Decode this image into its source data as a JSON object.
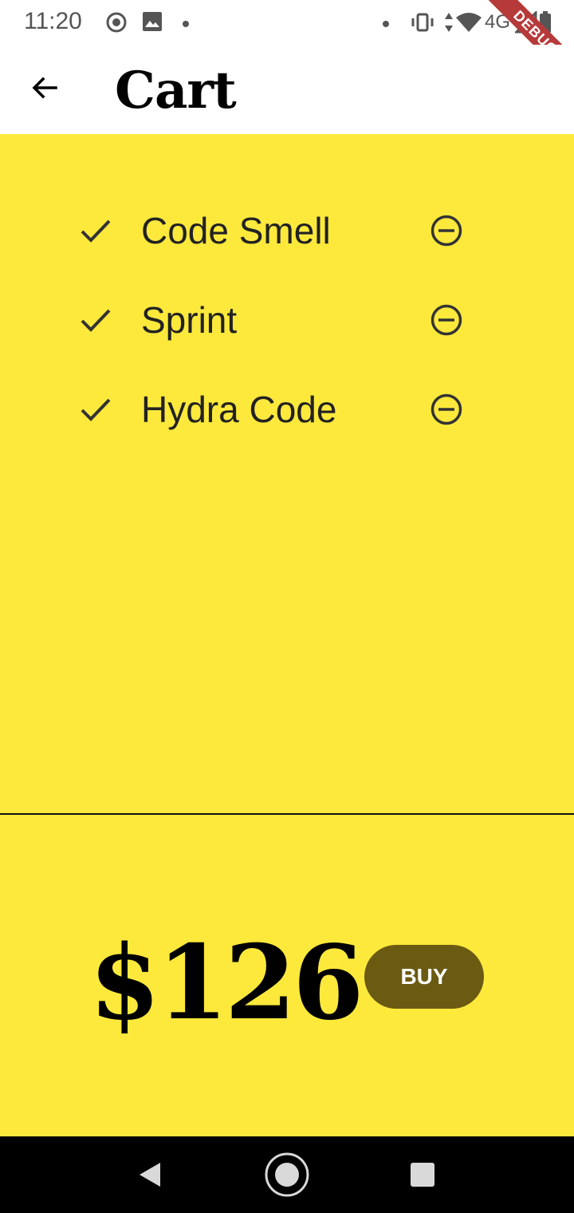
{
  "status_bar": {
    "time": "11:20",
    "network": "4G",
    "debug_label": "DEBUG",
    "icons": [
      "play-circle-icon",
      "image-icon",
      "notification-dot-icon",
      "vibrate-icon",
      "data-arrows-icon",
      "wifi-icon",
      "signal-icon",
      "battery-icon"
    ]
  },
  "app_bar": {
    "title": "Cart",
    "back_icon": "arrow-left-icon"
  },
  "cart": {
    "items": [
      {
        "label": "Code Smell"
      },
      {
        "label": "Sprint"
      },
      {
        "label": "Hydra Code"
      }
    ],
    "item_icon": "check-icon",
    "remove_icon": "remove-circle-icon"
  },
  "total": {
    "price": "$126",
    "buy_label": "BUY"
  },
  "nav_bar": {
    "icons": [
      "back-triangle-icon",
      "home-circle-icon",
      "recents-square-icon"
    ]
  },
  "colors": {
    "background_yellow": "#fde93c",
    "buy_button": "#6b5a12",
    "debug_ribbon": "#b63a3a"
  }
}
